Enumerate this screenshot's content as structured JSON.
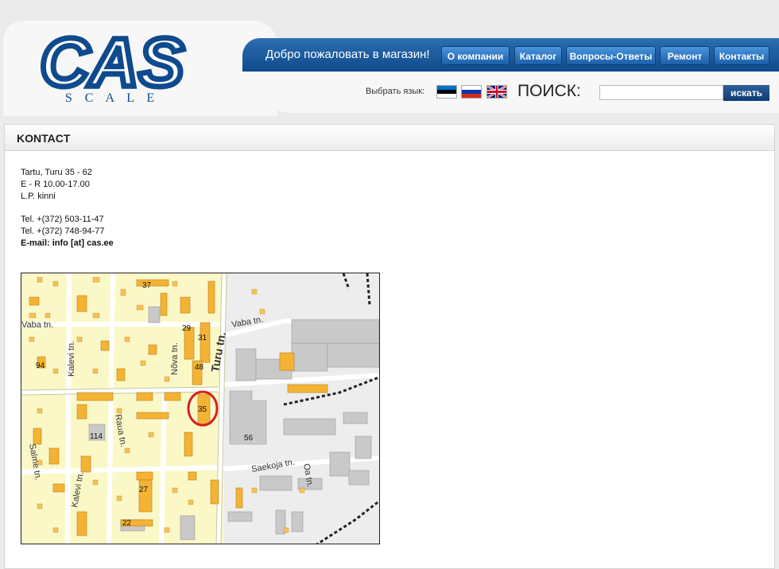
{
  "logo": {
    "text": "CAS",
    "subtext": "S C A L E"
  },
  "header": {
    "welcome": "Добро пожаловать в магазин!",
    "nav": [
      {
        "label": "О компании"
      },
      {
        "label": "Каталог"
      },
      {
        "label": "Вопросы-Ответы"
      },
      {
        "label": "Ремонт"
      },
      {
        "label": "Контакты"
      }
    ],
    "language_label": "Выбрать язык:",
    "flags": [
      "estonia-flag-icon",
      "russia-flag-icon",
      "uk-flag-icon"
    ],
    "search": {
      "label": "ПОИСК:",
      "value": "",
      "button": "искать"
    }
  },
  "page": {
    "title": "KONTACT",
    "address": "Tartu, Turu 35 - 62",
    "hours": "E - R 10.00-17.00",
    "closed": "L.P. kinni",
    "phone1": "Tel. +(372) 503-11-47",
    "phone2": "Tel. +(372) 748-94-77",
    "email": "E-mail: info [at] cas.ee"
  },
  "map": {
    "streets": [
      "Turu tn.",
      "Vaba tn.",
      "Vaba tn.",
      "Nõva tn.",
      "Kalevi tn.",
      "Kalevi tn.",
      "Salme tn.",
      "Raua tn.",
      "Saekoja tn.",
      "Oa tn."
    ],
    "numbers": [
      "37",
      "29",
      "31",
      "48",
      "94",
      "35",
      "56",
      "114",
      "27",
      "22"
    ]
  },
  "colors": {
    "brand_blue": "#0e4a8d",
    "nav_blue": "#1b5fa8",
    "map_bg": "#fbf8c8",
    "building_orange": "#f5b335",
    "marker_red": "#d42020"
  }
}
